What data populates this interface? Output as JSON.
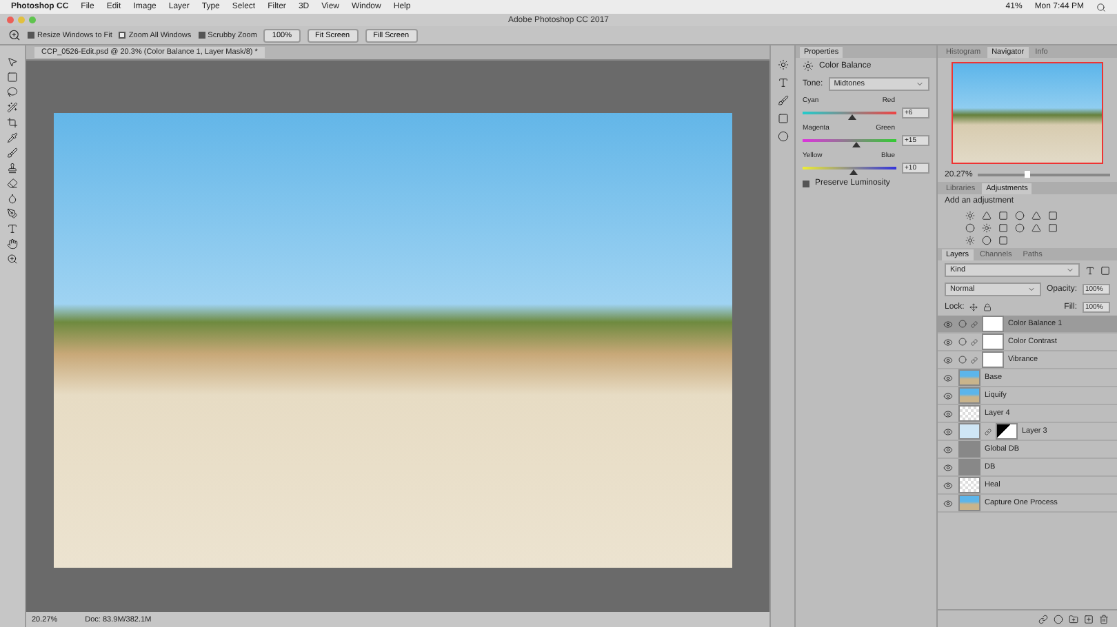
{
  "menu_bar": {
    "app": "Photoshop CC",
    "items": [
      "File",
      "Edit",
      "Image",
      "Layer",
      "Type",
      "Select",
      "Filter",
      "3D",
      "View",
      "Window",
      "Help"
    ],
    "battery": "41%",
    "clock": "Mon 7:44 PM"
  },
  "window": {
    "title": "Adobe Photoshop CC 2017"
  },
  "options_bar": {
    "checkboxes": [
      {
        "label": "Resize Windows to Fit",
        "checked": true
      },
      {
        "label": "Zoom All Windows",
        "checked": false
      },
      {
        "label": "Scrubby Zoom",
        "checked": true
      }
    ],
    "buttons": [
      "100%",
      "Fit Screen",
      "Fill Screen"
    ]
  },
  "document": {
    "tab": "CCP_0526-Edit.psd @ 20.3% (Color Balance 1, Layer Mask/8) *",
    "zoom": "20.27%",
    "doc_size": "Doc: 83.9M/382.1M"
  },
  "properties": {
    "title": "Properties",
    "adjustment": "Color Balance",
    "tone_label": "Tone:",
    "tone": "Midtones",
    "sliders": [
      {
        "left": "Cyan",
        "right": "Red",
        "value": "+6",
        "level": 0.53,
        "kind": "cyan-red"
      },
      {
        "left": "Magenta",
        "right": "Green",
        "value": "+15",
        "level": 0.57,
        "kind": "magenta-green"
      },
      {
        "left": "Yellow",
        "right": "Blue",
        "value": "+10",
        "level": 0.55,
        "kind": "yellow-blue"
      }
    ],
    "preserve_luminosity": {
      "label": "Preserve Luminosity",
      "checked": true
    }
  },
  "navigator": {
    "tabs": [
      {
        "label": "Histogram",
        "selected": false
      },
      {
        "label": "Navigator",
        "selected": true
      },
      {
        "label": "Info",
        "selected": false
      }
    ],
    "zoom": "20.27%",
    "level": 0.37
  },
  "adjustments": {
    "tabs": [
      {
        "label": "Libraries",
        "selected": false
      },
      {
        "label": "Adjustments",
        "selected": true
      }
    ],
    "hint": "Add an adjustment"
  },
  "layers": {
    "tabs": [
      {
        "label": "Layers",
        "selected": true
      },
      {
        "label": "Channels",
        "selected": false
      },
      {
        "label": "Paths",
        "selected": false
      }
    ],
    "filter": "Kind",
    "blend": "Normal",
    "opacity_label": "Opacity:",
    "opacity": "100%",
    "lock_label": "Lock:",
    "fill_label": "Fill:",
    "fill": "100%",
    "items": [
      {
        "name": "Color Balance 1",
        "kind": "adjustment",
        "visible": true,
        "selected": true
      },
      {
        "name": "Color Contrast",
        "kind": "adjustment",
        "visible": true,
        "selected": false
      },
      {
        "name": "Vibrance",
        "kind": "adjustment",
        "visible": true,
        "selected": false
      },
      {
        "name": "Base",
        "kind": "photo",
        "visible": true,
        "selected": false
      },
      {
        "name": "Liquify",
        "kind": "photo",
        "visible": true,
        "selected": false
      },
      {
        "name": "Layer 4",
        "kind": "transparent",
        "visible": true,
        "selected": false
      },
      {
        "name": "Layer 3",
        "kind": "masked",
        "visible": true,
        "selected": false
      },
      {
        "name": "Global DB",
        "kind": "gray",
        "visible": true,
        "selected": false
      },
      {
        "name": "DB",
        "kind": "gray",
        "visible": true,
        "selected": false
      },
      {
        "name": "Heal",
        "kind": "transparent",
        "visible": true,
        "selected": false
      },
      {
        "name": "Capture One Process",
        "kind": "photo",
        "visible": true,
        "selected": false
      }
    ]
  }
}
